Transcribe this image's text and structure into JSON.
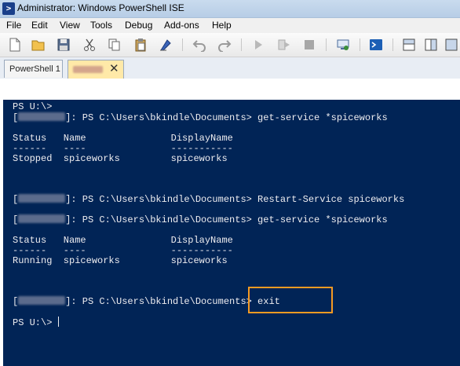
{
  "window": {
    "title": "Administrator: Windows PowerShell ISE"
  },
  "menu": [
    "File",
    "Edit",
    "View",
    "Tools",
    "Debug",
    "Add-ons",
    "Help"
  ],
  "toolbar": {
    "icons": [
      "new-icon",
      "open-icon",
      "save-icon",
      "cut-icon",
      "copy-icon",
      "paste-icon",
      "clear-icon",
      "undo-icon",
      "redo-icon",
      "run-icon",
      "run-selection-icon",
      "stop-icon",
      "remote-powershell-icon",
      "powershell-console-icon",
      "show-script-pane-top-icon",
      "show-script-pane-right-icon",
      "show-script-pane-max-icon"
    ]
  },
  "tabs": [
    {
      "label": "PowerShell 1"
    },
    {
      "label": "",
      "close": "✕"
    }
  ],
  "console": {
    "lines": [
      "PS U:\\>",
      "]: PS C:\\Users\\bkindle\\Documents> get-service *spiceworks",
      "Status   Name               DisplayName",
      "------   ----               -----------",
      "Stopped  spiceworks         spiceworks",
      "]: PS C:\\Users\\bkindle\\Documents> Restart-Service spiceworks",
      "]: PS C:\\Users\\bkindle\\Documents> get-service *spiceworks",
      "Status   Name               DisplayName",
      "------   ----               -----------",
      "Running  spiceworks         spiceworks",
      "]: PS C:\\Users\\bkindle\\Documents> exit",
      "PS U:\\> "
    ]
  },
  "colors": {
    "console_bg": "#012456",
    "console_fg": "#eeedf0",
    "highlight": "#f59a23"
  }
}
